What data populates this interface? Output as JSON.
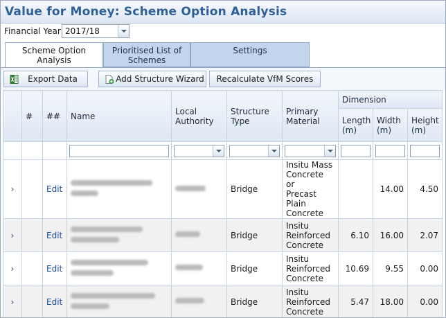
{
  "header": {
    "title": "Value for Money: Scheme Option Analysis"
  },
  "financial_year": {
    "label": "Financial Year:",
    "value": "2017/18"
  },
  "tabs": [
    {
      "line1": "Scheme Option",
      "line2": "Analysis"
    },
    {
      "line1": "Prioritised List of",
      "line2": "Schemes"
    },
    {
      "line1": "Settings",
      "line2": ""
    }
  ],
  "toolbar": {
    "export_label": "Export Data",
    "add_structure_label": "Add Structure Wizard",
    "recalc_label": "Recalculate VfM Scores"
  },
  "columns": {
    "hash": "#",
    "dhash": "##",
    "name": "Name",
    "authority_1": "Local",
    "authority_2": "Authority",
    "type_1": "Structure",
    "type_2": "Type",
    "material_1": "Primary",
    "material_2": "Material",
    "dimension": "Dimension",
    "length_1": "Length",
    "length_2": "(m)",
    "width_1": "Width",
    "width_2": "(m)",
    "height_1": "Height",
    "height_2": "(m)"
  },
  "rows": [
    {
      "expand": "›",
      "edit": "Edit",
      "type": "Bridge",
      "material": [
        "Insitu Mass",
        "Concrete or",
        "Precast",
        "Plain",
        "Concrete"
      ],
      "length": "",
      "width": "14.00",
      "height": "4.50"
    },
    {
      "expand": "›",
      "edit": "Edit",
      "type": "Bridge",
      "material": [
        "Insitu",
        "Reinforced",
        "Concrete"
      ],
      "length": "6.10",
      "width": "16.00",
      "height": "2.07"
    },
    {
      "expand": "›",
      "edit": "Edit",
      "type": "Bridge",
      "material": [
        "Insitu",
        "Reinforced",
        "Concrete"
      ],
      "length": "10.69",
      "width": "9.55",
      "height": "0.00"
    },
    {
      "expand": "›",
      "edit": "Edit",
      "type": "Bridge",
      "material": [
        "Insitu",
        "Reinforced",
        "Concrete"
      ],
      "length": "5.47",
      "width": "18.00",
      "height": "0.00"
    }
  ]
}
